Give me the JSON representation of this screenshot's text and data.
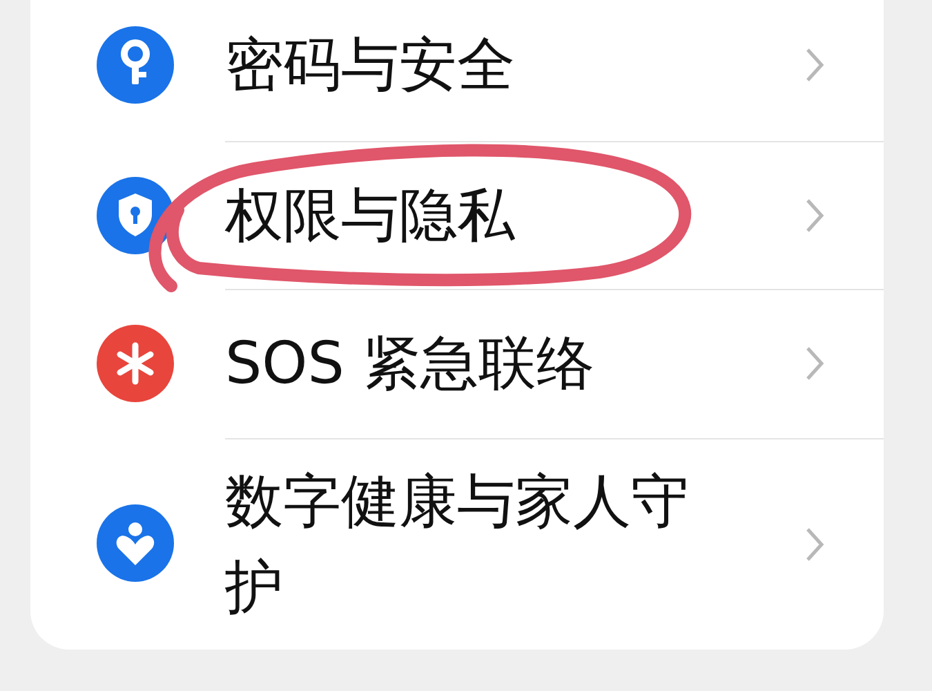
{
  "settings_items": [
    {
      "label": "密码与安全",
      "kind": "key",
      "color": "#1a73e8",
      "circled": false
    },
    {
      "label": "权限与隐私",
      "kind": "shield",
      "color": "#1a73e8",
      "circled": true
    },
    {
      "label": "SOS 紧急联络",
      "kind": "sos",
      "color": "#e8453c",
      "circled": false
    },
    {
      "label": "数字健康与家人守护",
      "kind": "heart",
      "color": "#1a73e8",
      "circled": false
    }
  ]
}
